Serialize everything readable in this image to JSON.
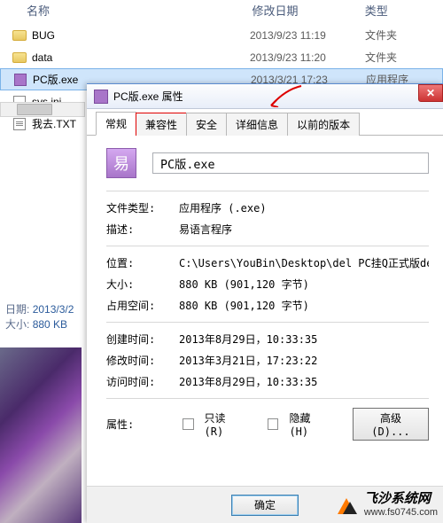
{
  "explorer": {
    "headers": {
      "name": "名称",
      "date": "修改日期",
      "type": "类型"
    },
    "rows": [
      {
        "icon": "folder",
        "name": "BUG",
        "date": "2013/9/23 11:19",
        "type": "文件夹"
      },
      {
        "icon": "folder",
        "name": "data",
        "date": "2013/9/23 11:20",
        "type": "文件夹"
      },
      {
        "icon": "exe",
        "name": "PC版.exe",
        "date": "2013/3/21 17:23",
        "type": "应用程序",
        "selected": true
      },
      {
        "icon": "ini",
        "name": "sys.ini",
        "date": "",
        "type": ""
      },
      {
        "icon": "txt",
        "name": "我去.TXT",
        "date": "",
        "type": ""
      }
    ]
  },
  "detail": {
    "date_label": "日期:",
    "date_value": "2013/3/2",
    "size_label": "大小:",
    "size_value": "880 KB"
  },
  "dialog": {
    "title": "PC版.exe 属性",
    "tabs": [
      "常规",
      "兼容性",
      "安全",
      "详细信息",
      "以前的版本"
    ],
    "active_tab": 0,
    "highlight_tab": 1,
    "filename": "PC版.exe",
    "props": {
      "filetype_label": "文件类型:",
      "filetype_value": "应用程序 (.exe)",
      "desc_label": "描述:",
      "desc_value": "易语言程序",
      "location_label": "位置:",
      "location_value": "C:\\Users\\YouBin\\Desktop\\del PC挂Q正式版del",
      "size_label": "大小:",
      "size_value": "880 KB (901,120 字节)",
      "disk_label": "占用空间:",
      "disk_value": "880 KB (901,120 字节)",
      "created_label": "创建时间:",
      "created_value": "2013年8月29日，10:33:35",
      "modified_label": "修改时间:",
      "modified_value": "2013年3月21日，17:23:22",
      "accessed_label": "访问时间:",
      "accessed_value": "2013年8月29日，10:33:35"
    },
    "attr_label": "属性:",
    "readonly_label": "只读(R)",
    "hidden_label": "隐藏(H)",
    "advanced_label": "高级(D)...",
    "ok": "确定"
  },
  "watermark": {
    "name": "飞沙系统网",
    "url": "www.fs0745.com"
  }
}
